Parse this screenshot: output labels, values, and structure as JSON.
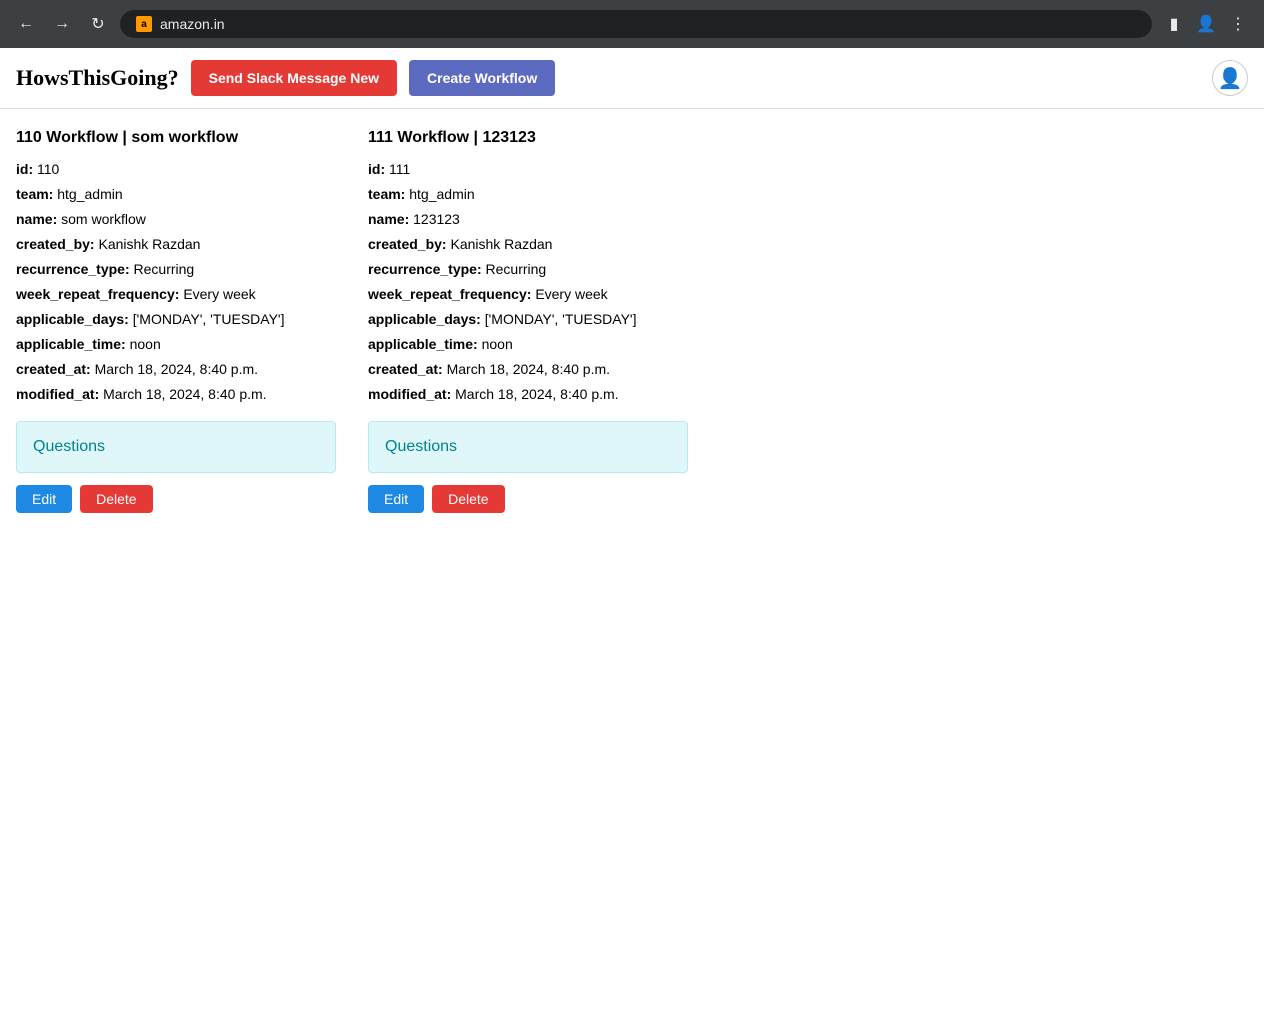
{
  "browser": {
    "url": "amazon.in",
    "favicon_letter": "a"
  },
  "header": {
    "logo": "HowsThisGoing?",
    "btn_slack_label": "Send Slack Message New",
    "btn_create_label": "Create Workflow"
  },
  "workflows": [
    {
      "title": "110 Workflow | som workflow",
      "id": "110",
      "team": "htg_admin",
      "name": "som workflow",
      "created_by": "Kanishk Razdan",
      "recurrence_type": "Recurring",
      "week_repeat_frequency": "Every week",
      "applicable_days": "['MONDAY', 'TUESDAY']",
      "applicable_time": "noon",
      "created_at": "March 18, 2024, 8:40 p.m.",
      "modified_at": "March 18, 2024, 8:40 p.m.",
      "questions_label": "Questions",
      "edit_label": "Edit",
      "delete_label": "Delete"
    },
    {
      "title": "111 Workflow | 123123",
      "id": "111",
      "team": "htg_admin",
      "name": "123123",
      "created_by": "Kanishk Razdan",
      "recurrence_type": "Recurring",
      "week_repeat_frequency": "Every week",
      "applicable_days": "['MONDAY', 'TUESDAY']",
      "applicable_time": "noon",
      "created_at": "March 18, 2024, 8:40 p.m.",
      "modified_at": "March 18, 2024, 8:40 p.m.",
      "questions_label": "Questions",
      "edit_label": "Edit",
      "delete_label": "Delete"
    }
  ],
  "labels": {
    "id": "id:",
    "team": "team:",
    "name": "name:",
    "created_by": "created_by:",
    "recurrence_type": "recurrence_type:",
    "week_repeat_frequency": "week_repeat_frequency:",
    "applicable_days": "applicable_days:",
    "applicable_time": "applicable_time:",
    "created_at": "created_at:",
    "modified_at": "modified_at:"
  }
}
